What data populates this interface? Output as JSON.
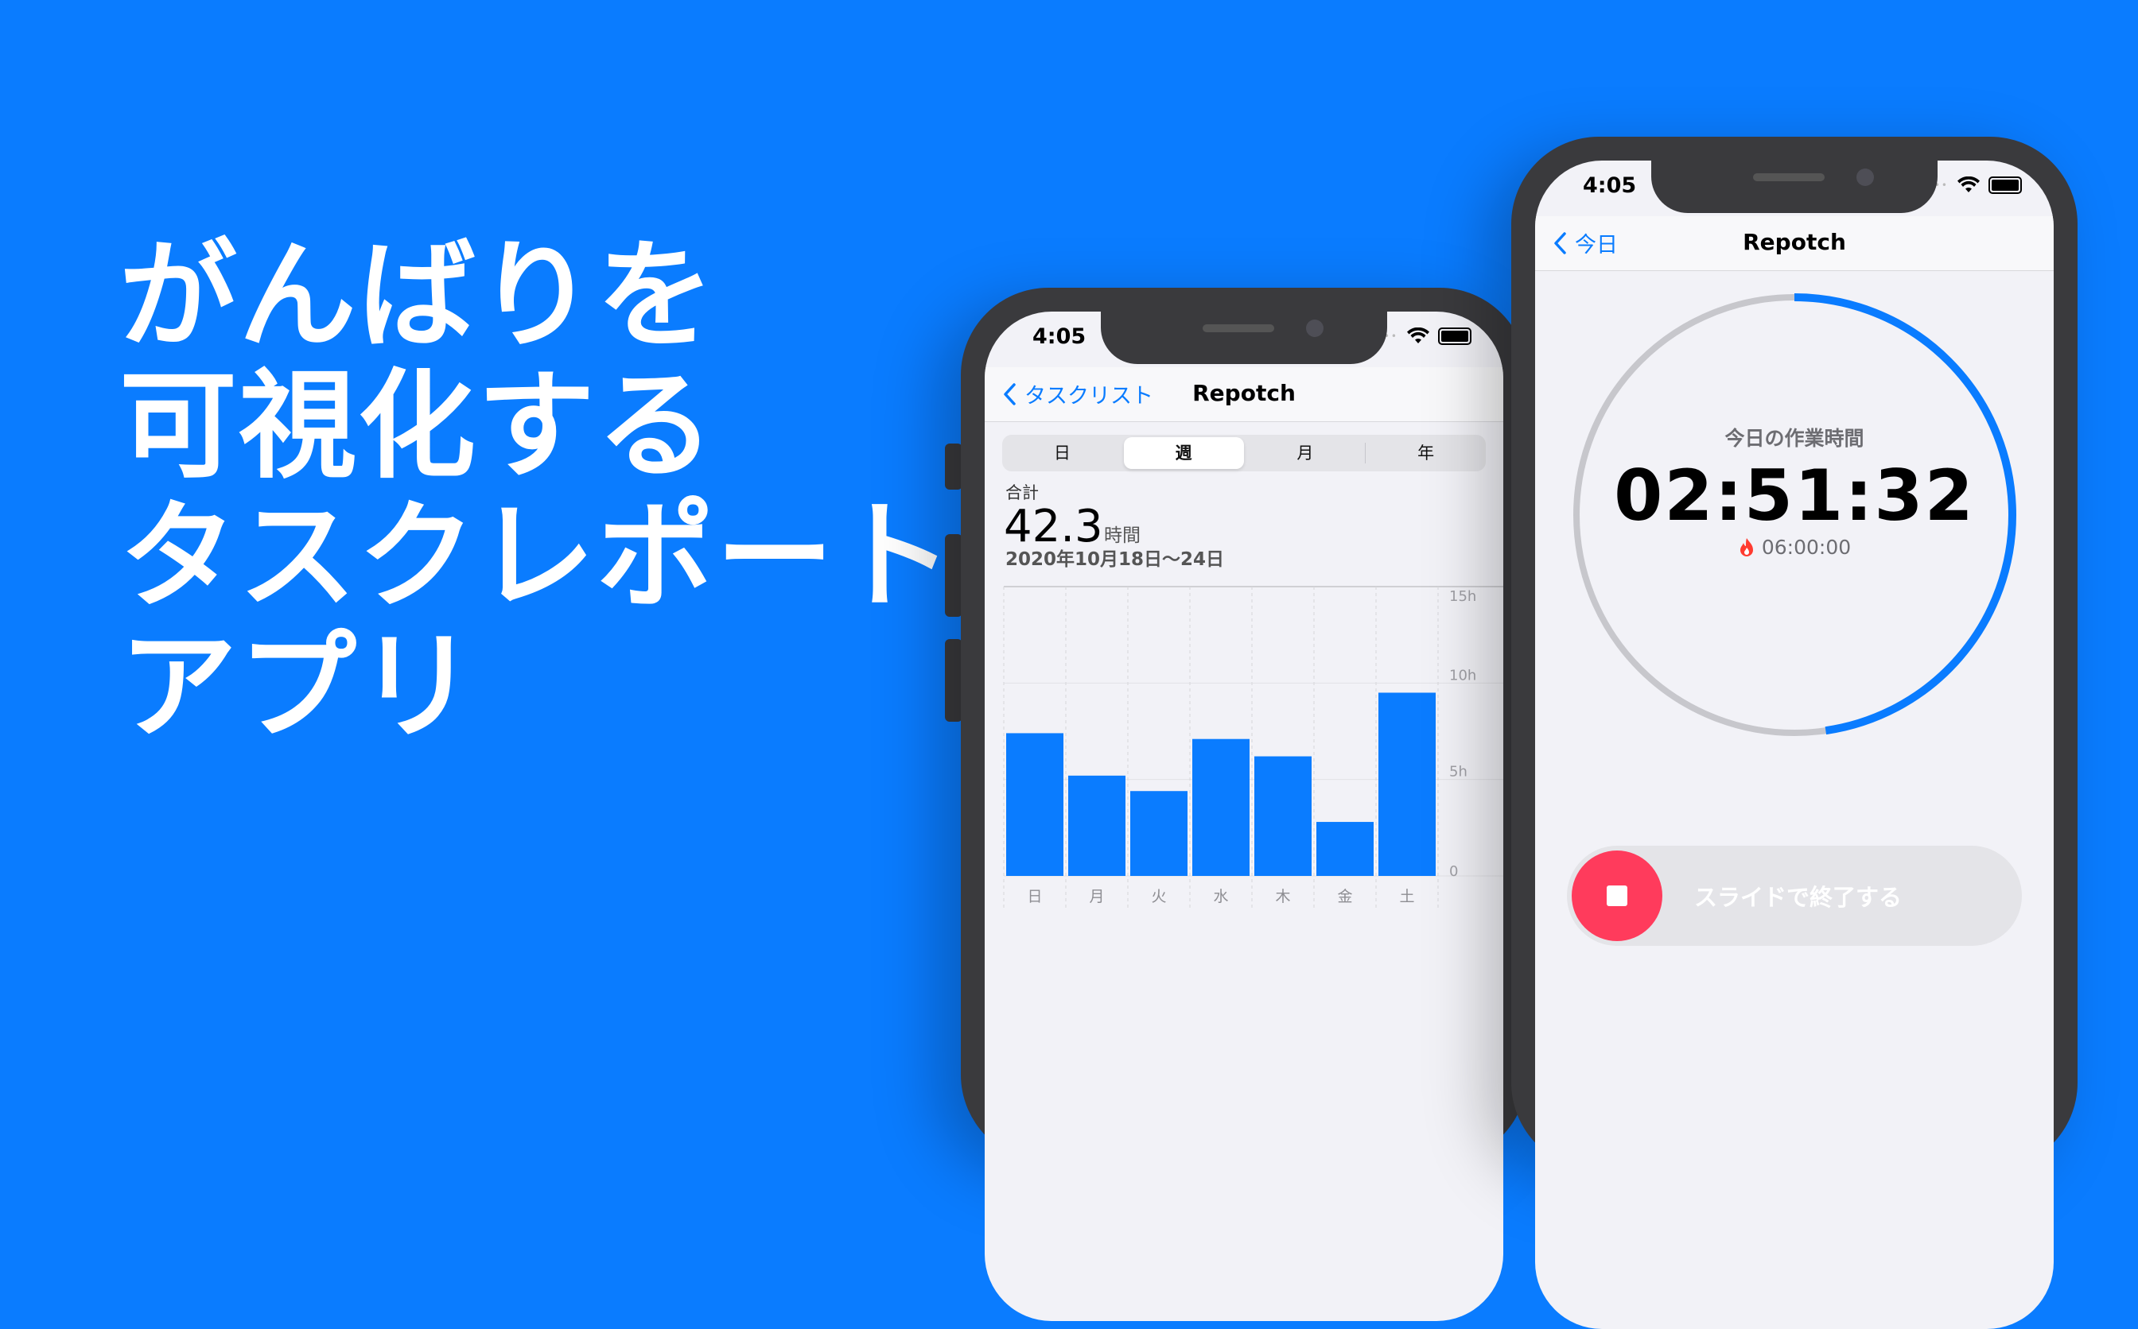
{
  "headline": [
    "がんばりを",
    "可視化する",
    "タスクレポート",
    "アプリ"
  ],
  "colors": {
    "background": "#0a7cff",
    "accent": "#0a7cff",
    "ring_track": "#c7c7cc",
    "stop": "#ff3b5c"
  },
  "report_screen": {
    "status_time": "4:05",
    "back_label": "タスクリスト",
    "title": "Repotch",
    "segments": [
      "日",
      "週",
      "月",
      "年"
    ],
    "selected_segment": "週",
    "summary_label": "合計",
    "summary_value": "42.3",
    "summary_unit": "時間",
    "date_range": "2020年10月18日〜24日"
  },
  "chart_data": {
    "type": "bar",
    "categories": [
      "日",
      "月",
      "火",
      "水",
      "木",
      "金",
      "土"
    ],
    "values": [
      7.4,
      5.2,
      4.4,
      7.1,
      6.2,
      2.8,
      9.5
    ],
    "y_ticks": [
      "15h",
      "10h",
      "5h",
      "0"
    ],
    "ylim": [
      0,
      15
    ],
    "grid": true,
    "color": "#0a7cff"
  },
  "timer_screen": {
    "status_time": "4:05",
    "back_label": "今日",
    "title": "Repotch",
    "today_label": "今日の作業時間",
    "elapsed": "02:51:32",
    "goal": "06:00:00",
    "progress": 0.477,
    "slide_label": "スライドで終了する"
  }
}
